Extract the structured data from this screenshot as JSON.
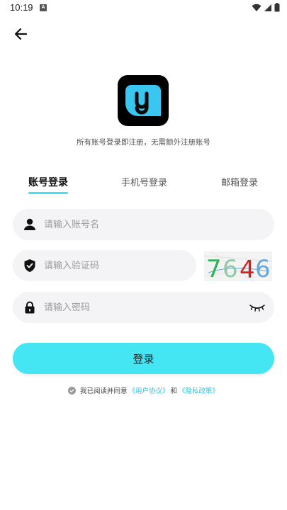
{
  "status_bar": {
    "time": "10:19",
    "notif_letter": "A"
  },
  "tagline": "所有账号登录即注册，无需额外注册账号",
  "tabs": [
    {
      "label": "账号登录",
      "active": true
    },
    {
      "label": "手机号登录",
      "active": false
    },
    {
      "label": "邮箱登录",
      "active": false
    }
  ],
  "fields": {
    "account_placeholder": "请输入账号名",
    "captcha_placeholder": "请输入验证码",
    "password_placeholder": "请输入密码"
  },
  "captcha": {
    "chars": [
      "7",
      "6",
      "4",
      "6"
    ],
    "colors": [
      "#2db35a",
      "#8fc9a8",
      "#d02222",
      "#6aa6e0"
    ]
  },
  "login_button": "登录",
  "agreement": {
    "prefix": "我已阅读并同意",
    "user_agreement": "《用户协议》",
    "and": "和",
    "privacy_policy": "《隐私政策》"
  },
  "colors": {
    "accent": "#44e6f4",
    "link": "#27c7e0",
    "field_bg": "#f4f4f6"
  }
}
